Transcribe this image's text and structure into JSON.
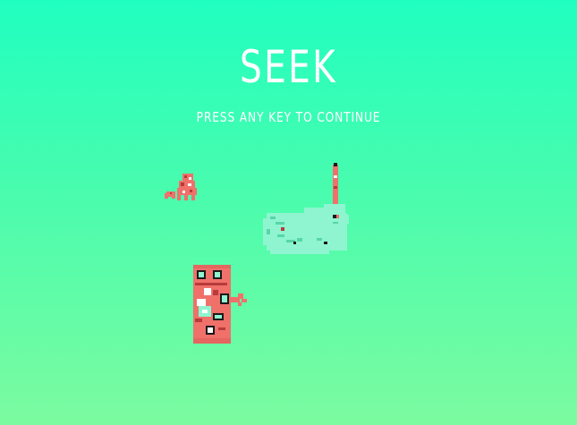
{
  "game": {
    "title": "SEEK",
    "prompt": "PRESS ANY KEY TO CONTINUE"
  },
  "colors": {
    "background_top": "#20ffc0",
    "background_bottom": "#7cfba0",
    "text": "#ffffff",
    "creature_red": "#f0706a",
    "creature_dark": "#b83a3a",
    "creature_mint": "#8ef5d0",
    "creature_mint_dark": "#58d6a6",
    "eye_black": "#1a1a1a"
  }
}
